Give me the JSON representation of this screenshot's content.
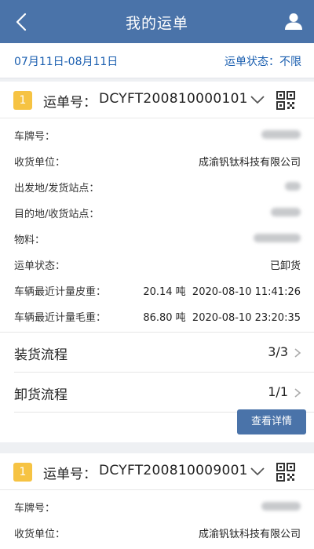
{
  "header": {
    "title": "我的运单",
    "back_icon": "back-icon",
    "user_icon": "user-icon",
    "bar_color": "#4a73a9"
  },
  "filter": {
    "date_range": "07月11日-08月11日",
    "status": "运单状态：不限",
    "accent": "#1b5fb0"
  },
  "cards": [
    {
      "index": "1",
      "order_label": "运单号：",
      "order_no": "DCYFT200810000101",
      "fields": [
        {
          "label": "车牌号：",
          "value": ""
        },
        {
          "label": "收货单位：",
          "value": "成渝钒钛科技有限公司"
        },
        {
          "label": "出发地/发货站点：",
          "value": ""
        },
        {
          "label": "目的地/收货站点：",
          "value": ""
        },
        {
          "label": "物料：",
          "value": ""
        },
        {
          "label": "运单状态：",
          "value": "已卸货"
        },
        {
          "label": "车辆最近计量皮重：",
          "value": "20.14 吨  2020-08-10 11:41:26"
        },
        {
          "label": "车辆最近计量毛重：",
          "value": "86.80 吨  2020-08-10 23:20:35"
        }
      ],
      "flows": [
        {
          "label": "装货流程",
          "value": "3/3"
        },
        {
          "label": "卸货流程",
          "value": "1/1"
        }
      ],
      "detail_button": "查看详情"
    },
    {
      "index": "1",
      "order_label": "运单号：",
      "order_no": "DCYFT200810009001",
      "fields": [
        {
          "label": "车牌号：",
          "value": ""
        },
        {
          "label": "收货单位：",
          "value": "成渝钒钛科技有限公司"
        }
      ]
    }
  ]
}
